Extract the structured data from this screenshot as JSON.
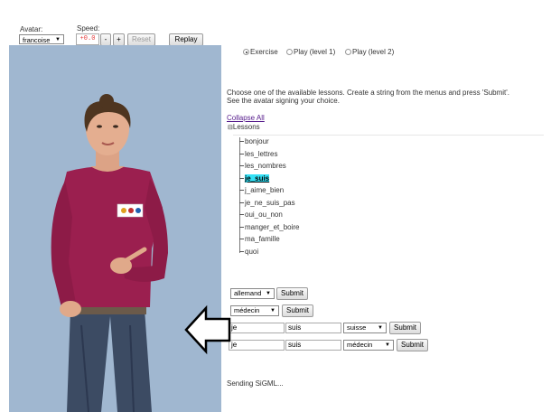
{
  "controls": {
    "avatar_label": "Avatar:",
    "avatar_value": "francoise",
    "speed_label": "Speed:",
    "speed_value": "+0.0",
    "minus": "-",
    "plus": "+",
    "reset": "Reset",
    "replay": "Replay"
  },
  "modes": [
    {
      "label": "Exercise",
      "selected": true
    },
    {
      "label": "Play (level 1)",
      "selected": false
    },
    {
      "label": "Play (level 2)",
      "selected": false
    }
  ],
  "instructions": {
    "line1": "Choose one of the available lessons. Create a string from the menus and press 'Submit'.",
    "line2": "See the avatar signing your choice."
  },
  "lessons": {
    "collapse_link": "Collapse All",
    "root": "Lessons",
    "items": [
      "bonjour",
      "les_lettres",
      "les_nombres",
      "je_suis",
      "j_aime_bien",
      "je_ne_suis_pas",
      "oui_ou_non",
      "manger_et_boire",
      "ma_famille",
      "quoi"
    ],
    "selected": "je_suis"
  },
  "exercise": {
    "language": "allemand",
    "word": "médecin",
    "submit": "Submit",
    "row1": {
      "a": "je",
      "b": "suis",
      "c": "suisse"
    },
    "row2": {
      "a": "je",
      "b": "suis",
      "c": "médecin"
    }
  },
  "status": "Sending SiGML...",
  "colors": {
    "avatar_bg": "#a0b7d0",
    "selection_highlight": "#33e0f5",
    "shirt": "#9b1f4f",
    "jeans": "#3c4b63"
  }
}
